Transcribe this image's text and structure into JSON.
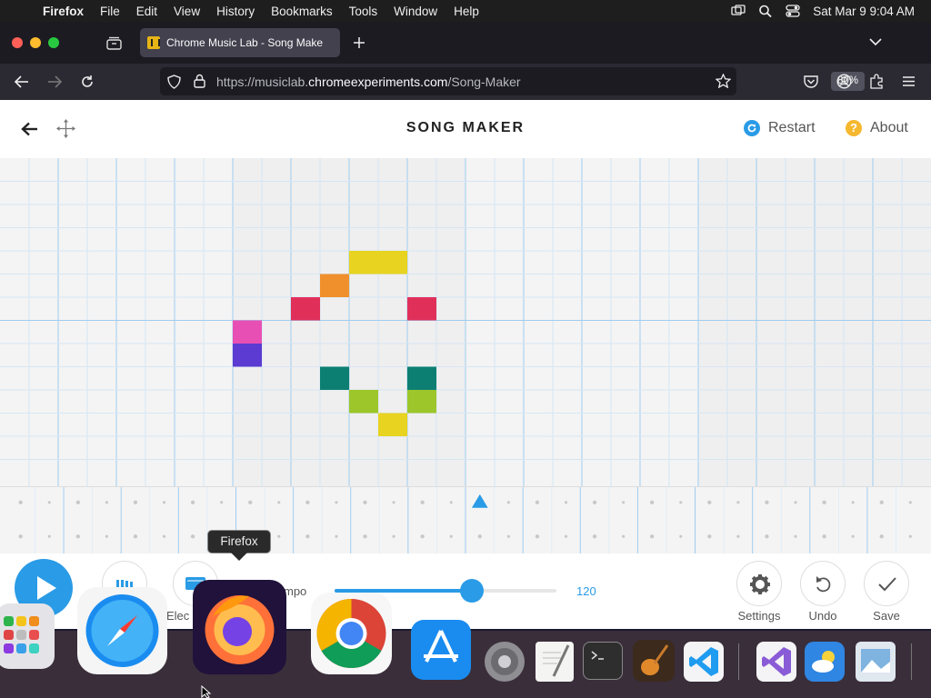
{
  "menubar": {
    "app": "Firefox",
    "items": [
      "File",
      "Edit",
      "View",
      "History",
      "Bookmarks",
      "Tools",
      "Window",
      "Help"
    ],
    "datetime": "Sat Mar 9  9:04 AM"
  },
  "browser": {
    "tab_title": "Chrome Music Lab - Song Make",
    "url_prefix": "https://musiclab.",
    "url_domain": "chromeexperiments.com",
    "url_path": "/Song-Maker",
    "zoom": "80%"
  },
  "app": {
    "title": "SONG MAKER",
    "restart_label": "Restart",
    "about_label": "About",
    "tempo_label": "Tempo",
    "tempo_visible_label": "mpo",
    "tempo_value": "120",
    "tempo_fraction": 0.62,
    "instrument_label": "Elec",
    "settings_label": "Settings",
    "undo_label": "Undo",
    "save_label": "Save",
    "tooltip": "Firefox"
  },
  "colors": {
    "accent": "#2a9be6",
    "yellow": "#e8d320",
    "orange": "#f0902c",
    "red": "#e0305a",
    "pink": "#e84fb4",
    "purple": "#5b3bd1",
    "teal": "#0d7f72",
    "green": "#9cc62a"
  },
  "notes": [
    {
      "col": 12,
      "row": 4,
      "color": "yellow"
    },
    {
      "col": 13,
      "row": 4,
      "color": "yellow"
    },
    {
      "col": 11,
      "row": 5,
      "color": "orange"
    },
    {
      "col": 10,
      "row": 6,
      "color": "red"
    },
    {
      "col": 14,
      "row": 6,
      "color": "red"
    },
    {
      "col": 8,
      "row": 7,
      "color": "pink"
    },
    {
      "col": 8,
      "row": 8,
      "color": "purple"
    },
    {
      "col": 11,
      "row": 9,
      "color": "teal"
    },
    {
      "col": 14,
      "row": 9,
      "color": "teal"
    },
    {
      "col": 12,
      "row": 10,
      "color": "green"
    },
    {
      "col": 14,
      "row": 10,
      "color": "green"
    },
    {
      "col": 13,
      "row": 11,
      "color": "yellow"
    }
  ],
  "playhead_col": 16,
  "dock": {
    "apps": [
      "launchpad",
      "safari",
      "firefox",
      "chrome",
      "app-store",
      "system-settings",
      "textedit",
      "terminal",
      "garageband",
      "vscode",
      "visual-studio",
      "weather",
      "preview"
    ]
  }
}
